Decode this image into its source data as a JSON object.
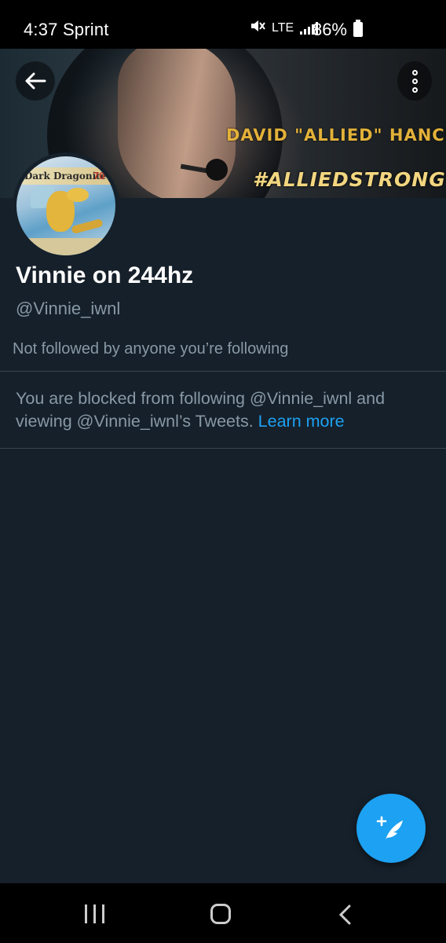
{
  "status_bar": {
    "time": "4:37",
    "carrier": "Sprint",
    "network": "LTE",
    "battery": "86%",
    "icons": [
      "mute-icon",
      "signal-icon",
      "battery-icon"
    ]
  },
  "banner": {
    "title": "DAVID \"ALLIED\" HANCE",
    "hashtag": "#ALLIEDSTRONG"
  },
  "avatar": {
    "card_name": "Dark Dragonite",
    "card_hp": "70"
  },
  "profile": {
    "display_name": "Vinnie on 244hz",
    "handle": "@Vinnie_iwnl",
    "follow_context": "Not followed by anyone you’re following"
  },
  "blocked_notice": {
    "text": "You are blocked from following @Vinnie_iwnl and viewing @Vinnie_iwnl’s Tweets.",
    "link": "Learn more"
  },
  "colors": {
    "background": "#15202b",
    "accent": "#1da1f2",
    "secondary_text": "#8899a6",
    "divider": "#38444d"
  }
}
